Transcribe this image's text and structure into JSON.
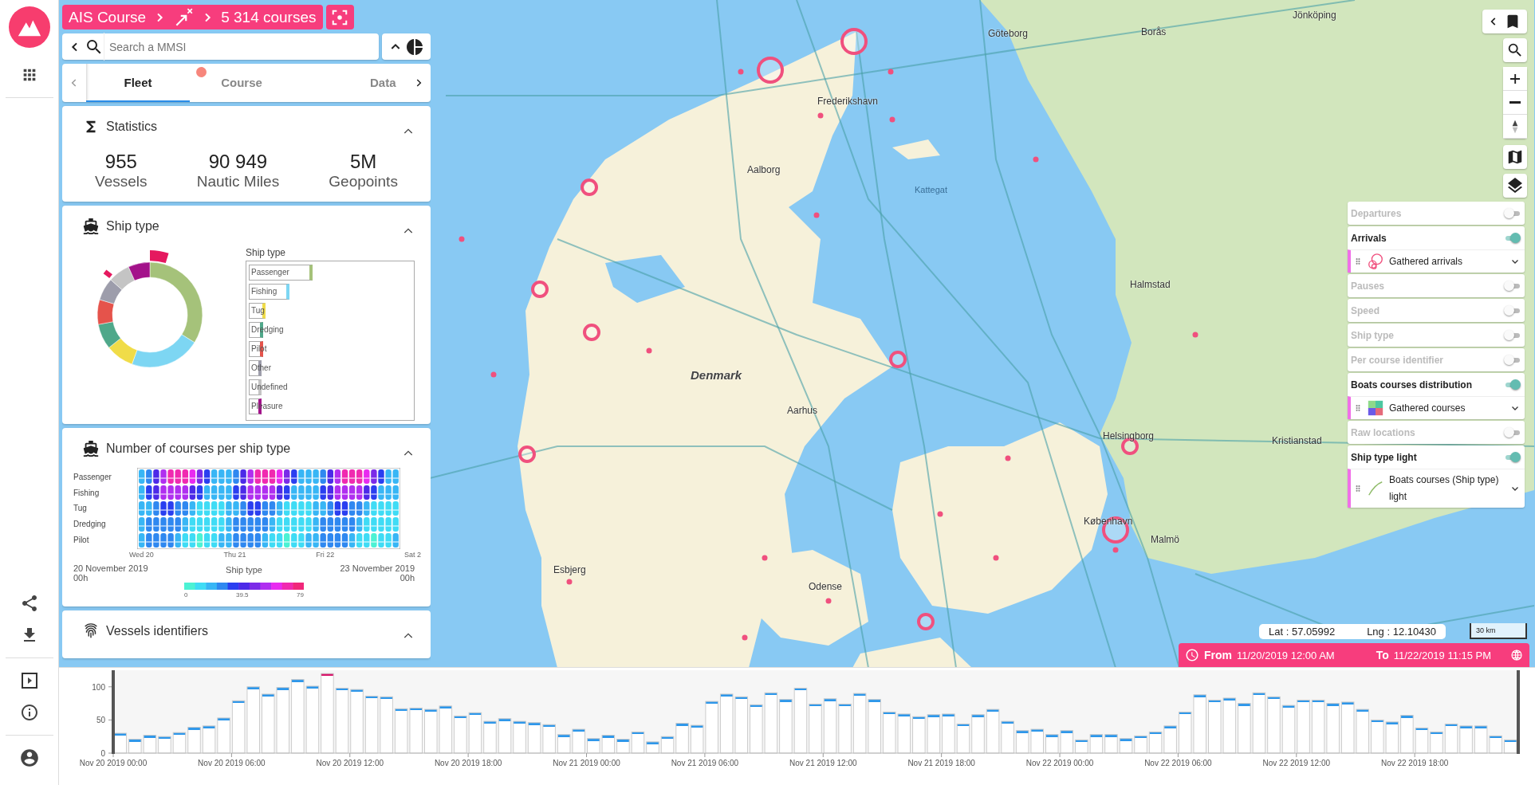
{
  "breadcrumb": {
    "title": "AIS Course",
    "count": "5 314 courses"
  },
  "search": {
    "placeholder": "Search a MMSI"
  },
  "tabs": [
    {
      "label": "Fleet",
      "selected": true,
      "badge": false
    },
    {
      "label": "Course",
      "selected": false,
      "badge": true
    },
    {
      "label": "Data",
      "selected": false,
      "badge": false
    }
  ],
  "statistics": {
    "title": "Statistics",
    "expanded": true,
    "items": [
      {
        "value": "955",
        "unit": "Vessels"
      },
      {
        "value": "90 949",
        "unit": "Nautic Miles"
      },
      {
        "value": "5M",
        "unit": "Geopoints"
      }
    ]
  },
  "ship_type": {
    "title": "Ship type",
    "expanded": true,
    "legend_title": "Ship type",
    "items": [
      {
        "label": "Passenger",
        "level": 0.39,
        "color": "#a5c27a"
      },
      {
        "label": "Fishing",
        "level": 0.25,
        "color": "#7dd6f3"
      },
      {
        "label": "Tug",
        "level": 0.1,
        "color": "#f0dc48"
      },
      {
        "label": "Dredging",
        "level": 0.09,
        "color": "#4fa88a"
      },
      {
        "label": "Pilot",
        "level": 0.088,
        "color": "#e5534b"
      },
      {
        "label": "Other",
        "level": 0.08,
        "color": "#9d9dab"
      },
      {
        "label": "Undefined",
        "level": 0.077,
        "color": "#c4c4c4"
      },
      {
        "label": "Pleasure",
        "level": 0.077,
        "color": "#a3128a"
      }
    ]
  },
  "courses_chart": {
    "title": "Number of courses per ship type",
    "expanded": true,
    "rows": [
      "Passenger",
      "Fishing",
      "Tug",
      "Dredging",
      "Pilot"
    ],
    "x_labels": [
      "Wed 20",
      "Thu 21",
      "Fri 22",
      "Sat 2"
    ],
    "start": [
      "20 November 2019",
      "00h"
    ],
    "measure": "Ship type",
    "end": [
      "23 November 2019",
      "00h"
    ],
    "scale_labels": [
      "0",
      "39.5",
      "79"
    ]
  },
  "vessels_identifiers": {
    "title": "Vessels identifiers",
    "expanded": true
  },
  "map": {
    "labels": [
      {
        "text": "Jönköping",
        "kind": "city"
      },
      {
        "text": "Göteborg",
        "kind": "city"
      },
      {
        "text": "Borås",
        "kind": "city"
      },
      {
        "text": "Frederikshavn",
        "kind": "city"
      },
      {
        "text": "Aalborg",
        "kind": "city"
      },
      {
        "text": "Kattegat",
        "kind": "sea"
      },
      {
        "text": "Halmstad",
        "kind": "city"
      },
      {
        "text": "Denmark",
        "kind": "country"
      },
      {
        "text": "Aarhus",
        "kind": "city"
      },
      {
        "text": "Helsingborg",
        "kind": "city"
      },
      {
        "text": "Kristianstad",
        "kind": "city"
      },
      {
        "text": "København",
        "kind": "city"
      },
      {
        "text": "Malmö",
        "kind": "city"
      },
      {
        "text": "Esbjerg",
        "kind": "city"
      },
      {
        "text": "Odense",
        "kind": "city"
      }
    ],
    "lat": "Lat : 57.05992",
    "lng": "Lng : 12.10430",
    "scale": "30 km"
  },
  "layers": [
    {
      "label": "Departures",
      "on": false
    },
    {
      "label": "Arrivals",
      "on": true,
      "sublayer": {
        "label": "Gathered arrivals",
        "kind": "circles"
      }
    },
    {
      "label": "Pauses",
      "on": false
    },
    {
      "label": "Speed",
      "on": false
    },
    {
      "label": "Ship type",
      "on": false
    },
    {
      "label": "Per course identifier",
      "on": false
    },
    {
      "label": "Boats courses distribution",
      "on": true,
      "sublayer": {
        "label": "Gathered courses",
        "kind": "grid"
      }
    },
    {
      "label": "Raw locations",
      "on": false
    },
    {
      "label": "Ship type light",
      "on": true,
      "sublayer": {
        "label": "Boats courses (Ship type) light",
        "kind": "line"
      }
    }
  ],
  "time_range": {
    "from_label": "From",
    "from": "11/20/2019 12:00 AM",
    "to_label": "To",
    "to": "11/22/2019 11:15 PM"
  },
  "timeline": {
    "chart_data": {
      "type": "bar",
      "categories": [
        "Nov 20 2019 00:00",
        null,
        null,
        null,
        null,
        null,
        null,
        null,
        "Nov 20 2019 06:00",
        null,
        null,
        null,
        null,
        null,
        null,
        null,
        "Nov 20 2019 12:00",
        null,
        null,
        null,
        null,
        null,
        null,
        null,
        "Nov 20 2019 18:00",
        null,
        null,
        null,
        null,
        null,
        null,
        null,
        "Nov 21 2019 00:00",
        null,
        null,
        null,
        null,
        null,
        null,
        null,
        "Nov 21 2019 06:00",
        null,
        null,
        null,
        null,
        null,
        null,
        null,
        "Nov 21 2019 12:00",
        null,
        null,
        null,
        null,
        null,
        null,
        null,
        "Nov 21 2019 18:00",
        null,
        null,
        null,
        null,
        null,
        null,
        null,
        "Nov 22 2019 00:00",
        null,
        null,
        null,
        null,
        null,
        null,
        null,
        "Nov 22 2019 06:00",
        null,
        null,
        null,
        null,
        null,
        null,
        null,
        "Nov 22 2019 12:00",
        null,
        null,
        null,
        null,
        null,
        null,
        null,
        "Nov 22 2019 18:00",
        null,
        null,
        null,
        null,
        null,
        null
      ],
      "values": [
        30,
        21,
        27,
        25,
        31,
        39,
        41,
        53,
        79,
        100,
        89,
        99,
        111,
        101,
        120,
        98,
        96,
        86,
        85,
        67,
        68,
        66,
        71,
        56,
        61,
        48,
        52,
        48,
        46,
        43,
        28,
        36,
        22,
        27,
        21,
        32,
        17,
        25,
        45,
        42,
        78,
        89,
        85,
        73,
        91,
        81,
        98,
        74,
        82,
        74,
        90,
        81,
        62,
        59,
        55,
        58,
        59,
        44,
        58,
        66,
        48,
        34,
        36,
        28,
        34,
        20,
        28,
        28,
        22,
        26,
        32,
        41,
        62,
        88,
        80,
        83,
        75,
        91,
        85,
        72,
        80,
        80,
        75,
        77,
        66,
        50,
        47,
        57,
        38,
        32,
        44,
        41,
        41,
        26,
        20
      ],
      "ylim": [
        0,
        125
      ],
      "yticks": [
        0,
        50,
        100
      ]
    }
  }
}
